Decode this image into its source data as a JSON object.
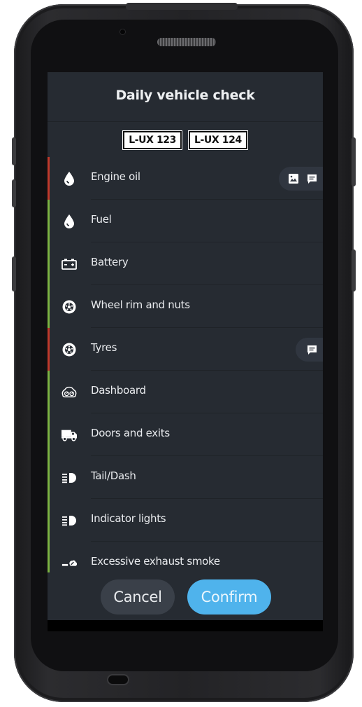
{
  "screen": {
    "title": "Daily vehicle check",
    "plates": [
      "L-UX 123",
      "L-UX 124"
    ]
  },
  "checks": [
    {
      "label": "Engine oil",
      "icon": "oil-drop-icon",
      "status": "fail",
      "actions": [
        "image-icon",
        "comment-icon"
      ]
    },
    {
      "label": "Fuel",
      "icon": "fuel-drop-icon",
      "status": "ok",
      "actions": []
    },
    {
      "label": "Battery",
      "icon": "battery-icon",
      "status": "ok",
      "actions": []
    },
    {
      "label": "Wheel rim and nuts",
      "icon": "wheel-icon",
      "status": "ok",
      "actions": []
    },
    {
      "label": "Tyres",
      "icon": "tyre-icon",
      "status": "fail",
      "actions": [
        "comment-icon"
      ]
    },
    {
      "label": "Dashboard",
      "icon": "dashboard-icon",
      "status": "ok",
      "actions": []
    },
    {
      "label": "Doors and exits",
      "icon": "truck-icon",
      "status": "ok",
      "actions": []
    },
    {
      "label": "Tail/Dash",
      "icon": "headlight-icon",
      "status": "ok",
      "actions": []
    },
    {
      "label": "Indicator lights",
      "icon": "indicator-light-icon",
      "status": "ok",
      "actions": []
    },
    {
      "label": "Excessive exhaust smoke",
      "icon": "exhaust-icon",
      "status": "ok",
      "actions": []
    }
  ],
  "footer": {
    "cancel_label": "Cancel",
    "confirm_label": "Confirm"
  },
  "colors": {
    "fail": "#c0392b",
    "ok": "#7cb342",
    "accent": "#4fb3ec",
    "background": "#262b32"
  }
}
